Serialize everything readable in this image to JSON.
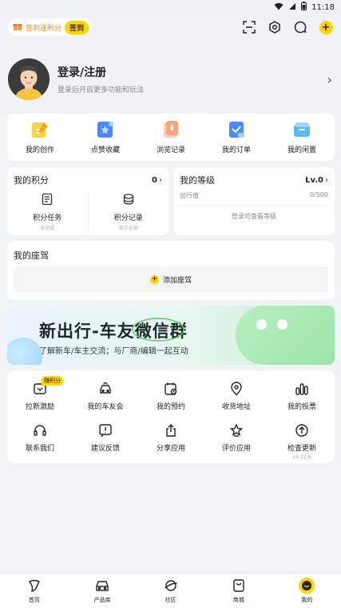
{
  "status_bar": {
    "time": "11:18"
  },
  "header": {
    "checkin_text": "签到送积分",
    "checkin_button": "签到",
    "plus_label": "+"
  },
  "profile": {
    "name": "登录/注册",
    "subtitle": "登录后开启更多功能和玩法",
    "arrow": "›"
  },
  "quick_actions": [
    {
      "label": "我的创作",
      "icon": "creation-icon",
      "color": "#ffd23f"
    },
    {
      "label": "点赞收藏",
      "icon": "like-collect-icon",
      "color": "#4a8cf7"
    },
    {
      "label": "浏览记录",
      "icon": "history-icon",
      "color": "#f7a57b"
    },
    {
      "label": "我的订单",
      "icon": "order-icon",
      "color": "#4a8cf7"
    },
    {
      "label": "我的闲置",
      "icon": "idle-icon",
      "color": "#5cb8f0"
    }
  ],
  "points": {
    "title": "我的积分",
    "value": "0",
    "arrow": "›",
    "tasks_label": "积分任务",
    "tasks_sub": "未完成",
    "records_label": "积分记录",
    "records_sub": "显示全部"
  },
  "level": {
    "title": "我的等级",
    "value": "Lv.0",
    "arrow": "›",
    "xp_label": "出行值",
    "xp_value": "0/500",
    "note": "登录可查看等级"
  },
  "seat": {
    "title": "我的座驾",
    "plus": "+",
    "add_label": "添加座驾"
  },
  "banner": {
    "title": "新出行-车友微信群",
    "subtitle": "了解新车/车主交流；与厂商/编辑一起互动"
  },
  "services": [
    {
      "label": "拉新激励",
      "icon": "invite-reward-icon",
      "badge": "赚积分"
    },
    {
      "label": "我的车友会",
      "icon": "car-club-icon"
    },
    {
      "label": "我的预约",
      "icon": "appointment-icon"
    },
    {
      "label": "收货地址",
      "icon": "location-pin-icon"
    },
    {
      "label": "我的投票",
      "icon": "vote-bars-icon"
    },
    {
      "label": "联系我们",
      "icon": "headset-icon"
    },
    {
      "label": "建议反馈",
      "icon": "feedback-icon"
    },
    {
      "label": "分享应用",
      "icon": "share-icon"
    },
    {
      "label": "评价应用",
      "icon": "rate-app-icon"
    },
    {
      "label": "检查更新",
      "icon": "update-arrow-icon",
      "version": "v4.22.6"
    }
  ],
  "tabs": [
    {
      "label": "首页",
      "icon": "home-icon"
    },
    {
      "label": "产品库",
      "icon": "car-icon"
    },
    {
      "label": "社区",
      "icon": "planet-icon"
    },
    {
      "label": "商城",
      "icon": "shopping-bag-icon"
    },
    {
      "label": "我的",
      "icon": "profile-face-icon",
      "active": true
    }
  ],
  "colors": {
    "accent": "#ffd400",
    "checkin_text": "#f08a2c",
    "background": "#f2f3f5"
  }
}
